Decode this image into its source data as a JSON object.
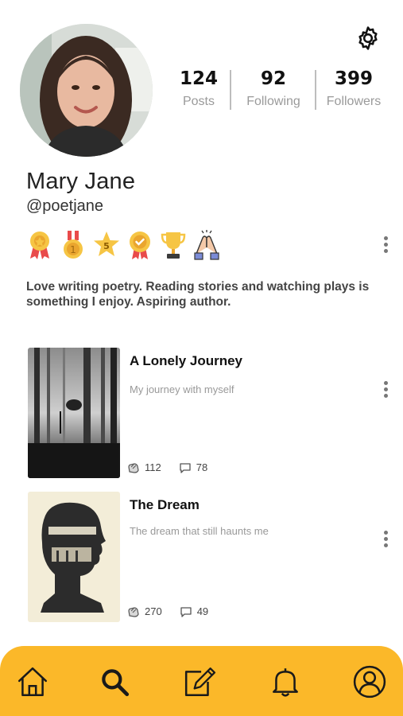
{
  "profile": {
    "name": "Mary Jane",
    "handle": "@poetjane",
    "bio": "Love writing poetry. Reading stories and watching plays is something I enjoy. Aspiring author."
  },
  "stats": [
    {
      "value": "124",
      "label": "Posts"
    },
    {
      "value": "92",
      "label": "Following"
    },
    {
      "value": "399",
      "label": "Followers"
    }
  ],
  "badges": [
    "medal-badge-icon",
    "gold-medal-icon",
    "star-five-icon",
    "check-medal-icon",
    "trophy-icon",
    "high-five-icon"
  ],
  "posts": [
    {
      "title": "A Lonely Journey",
      "subtitle": "My journey with myself",
      "likes": "112",
      "comments": "78"
    },
    {
      "title": "The Dream",
      "subtitle": "The dream that still haunts me",
      "likes": "270",
      "comments": "49"
    }
  ],
  "nav": [
    "home-icon",
    "search-icon",
    "compose-icon",
    "notifications-icon",
    "profile-icon"
  ],
  "colors": {
    "accent": "#fbb829",
    "text": "#1e1e1e",
    "muted": "#9a9a9a"
  }
}
